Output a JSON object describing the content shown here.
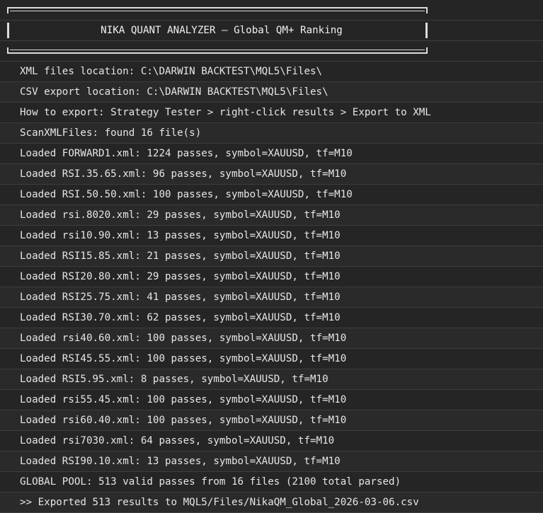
{
  "banner": {
    "title": "NIKA QUANT ANALYZER — Global QM+ Ranking"
  },
  "log_lines": [
    "XML files location: C:\\DARWIN BACKTEST\\MQL5\\Files\\",
    "CSV export location: C:\\DARWIN BACKTEST\\MQL5\\Files\\",
    "How to export: Strategy Tester > right-click results > Export to XML",
    "ScanXMLFiles: found 16 file(s)",
    "Loaded FORWARD1.xml: 1224 passes, symbol=XAUUSD, tf=M10",
    "Loaded RSI.35.65.xml: 96 passes, symbol=XAUUSD, tf=M10",
    "Loaded RSI.50.50.xml: 100 passes, symbol=XAUUSD, tf=M10",
    "Loaded rsi.8020.xml: 29 passes, symbol=XAUUSD, tf=M10",
    "Loaded rsi10.90.xml: 13 passes, symbol=XAUUSD, tf=M10",
    "Loaded RSI15.85.xml: 21 passes, symbol=XAUUSD, tf=M10",
    "Loaded RSI20.80.xml: 29 passes, symbol=XAUUSD, tf=M10",
    "Loaded RSI25.75.xml: 41 passes, symbol=XAUUSD, tf=M10",
    "Loaded RSI30.70.xml: 62 passes, symbol=XAUUSD, tf=M10",
    "Loaded rsi40.60.xml: 100 passes, symbol=XAUUSD, tf=M10",
    "Loaded RSI45.55.xml: 100 passes, symbol=XAUUSD, tf=M10",
    "Loaded RSI5.95.xml: 8 passes, symbol=XAUUSD, tf=M10",
    "Loaded rsi55.45.xml: 100 passes, symbol=XAUUSD, tf=M10",
    "Loaded rsi60.40.xml: 100 passes, symbol=XAUUSD, tf=M10",
    "Loaded rsi7030.xml: 64 passes, symbol=XAUUSD, tf=M10",
    "Loaded RSI90.10.xml: 13 passes, symbol=XAUUSD, tf=M10",
    "GLOBAL POOL: 513 valid passes from 16 files (2100 total parsed)",
    ">> Exported 513 results to MQL5/Files/NikaQM_Global_2026-03-06.csv"
  ]
}
